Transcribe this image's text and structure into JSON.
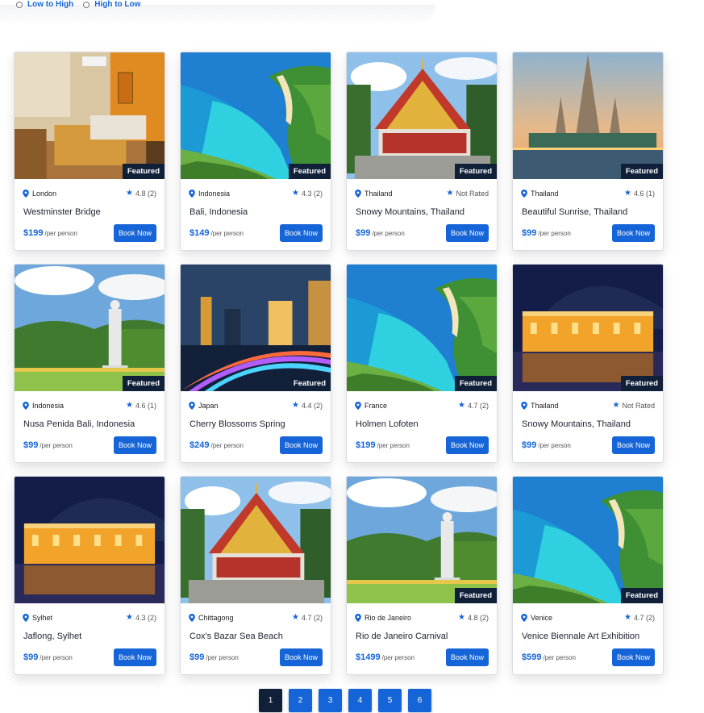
{
  "sort": {
    "options": [
      "Low to High",
      "High to Low"
    ]
  },
  "cards": [
    {
      "location": "London",
      "rating": "4.8 (2)",
      "title": "Westminster Bridge",
      "price": "$199",
      "per": "/per person",
      "cta": "Book Now",
      "featured": "Featured",
      "scene": "room"
    },
    {
      "location": "Indonesia",
      "rating": "4.3 (2)",
      "title": "Bali, Indonesia",
      "price": "$149",
      "per": "/per person",
      "cta": "Book Now",
      "featured": "Featured",
      "scene": "beach"
    },
    {
      "location": "Thailand",
      "rating": "Not Rated",
      "title": "Snowy Mountains, Thailand",
      "price": "$99",
      "per": "/per person",
      "cta": "Book Now",
      "featured": "Featured",
      "scene": "temple"
    },
    {
      "location": "Thailand",
      "rating": "4.6 (1)",
      "title": "Beautiful Sunrise, Thailand",
      "price": "$99",
      "per": "/per person",
      "cta": "Book Now",
      "featured": "Featured",
      "scene": "watarun"
    },
    {
      "location": "Indonesia",
      "rating": "4.6 (1)",
      "title": "Nusa Penida Bali, Indonesia",
      "price": "$99",
      "per": "/per person",
      "cta": "Book Now",
      "featured": "Featured",
      "scene": "statue"
    },
    {
      "location": "Japan",
      "rating": "4.4 (2)",
      "title": "Cherry Blossoms Spring",
      "price": "$249",
      "per": "/per person",
      "cta": "Book Now",
      "featured": "Featured",
      "scene": "city"
    },
    {
      "location": "France",
      "rating": "4.7 (2)",
      "title": "Holmen Lofoten",
      "price": "$199",
      "per": "/per person",
      "cta": "Book Now",
      "featured": "Featured",
      "scene": "beach"
    },
    {
      "location": "Thailand",
      "rating": "Not Rated",
      "title": "Snowy Mountains, Thailand",
      "price": "$99",
      "per": "/per person",
      "cta": "Book Now",
      "featured": "Featured",
      "scene": "palace"
    },
    {
      "location": "Sylhet",
      "rating": "4.3 (2)",
      "title": "Jaflong, Sylhet",
      "price": "$99",
      "per": "/per person",
      "cta": "Book Now",
      "featured": "",
      "scene": "palace"
    },
    {
      "location": "Chittagong",
      "rating": "4.7 (2)",
      "title": "Cox's Bazar Sea Beach",
      "price": "$99",
      "per": "/per person",
      "cta": "Book Now",
      "featured": "",
      "scene": "temple"
    },
    {
      "location": "Rio de Janeiro",
      "rating": "4.8 (2)",
      "title": "Rio de Janeiro Carnival",
      "price": "$1499",
      "per": "/per person",
      "cta": "Book Now",
      "featured": "Featured",
      "scene": "statue"
    },
    {
      "location": "Venice",
      "rating": "4.7 (2)",
      "title": "Venice Biennale Art Exhibition",
      "price": "$599",
      "per": "/per person",
      "cta": "Book Now",
      "featured": "Featured",
      "scene": "beach"
    }
  ],
  "pagination": {
    "pages": [
      "1",
      "2",
      "3",
      "4",
      "5",
      "6"
    ],
    "active": "1"
  },
  "colors": {
    "accent": "#1565d8",
    "dark": "#0f2038"
  }
}
